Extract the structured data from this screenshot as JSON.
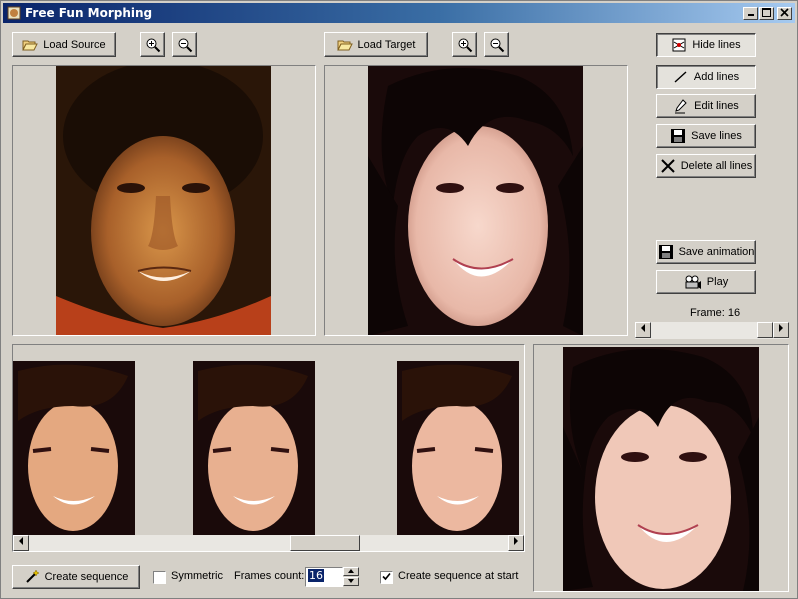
{
  "window": {
    "title": "Free Fun Morphing"
  },
  "toolbar": {
    "load_source": "Load Source",
    "load_target": "Load Target"
  },
  "side": {
    "hide_lines": "Hide lines",
    "add_lines": "Add lines",
    "edit_lines": "Edit lines",
    "save_lines": "Save lines",
    "delete_all_lines": "Delete all lines",
    "save_animation": "Save animation",
    "play": "Play",
    "frame_label": "Frame: 16",
    "frame_value": 16
  },
  "bottom": {
    "create_sequence": "Create sequence",
    "symmetric": "Symmetric",
    "symmetric_checked": false,
    "frames_count_label": "Frames count:",
    "frames_count": "16",
    "create_at_start": "Create sequence at start",
    "create_at_start_checked": true
  },
  "colors": {
    "title_start": "#0a246a",
    "title_end": "#a6caf0",
    "face": "#f0c8b8"
  }
}
